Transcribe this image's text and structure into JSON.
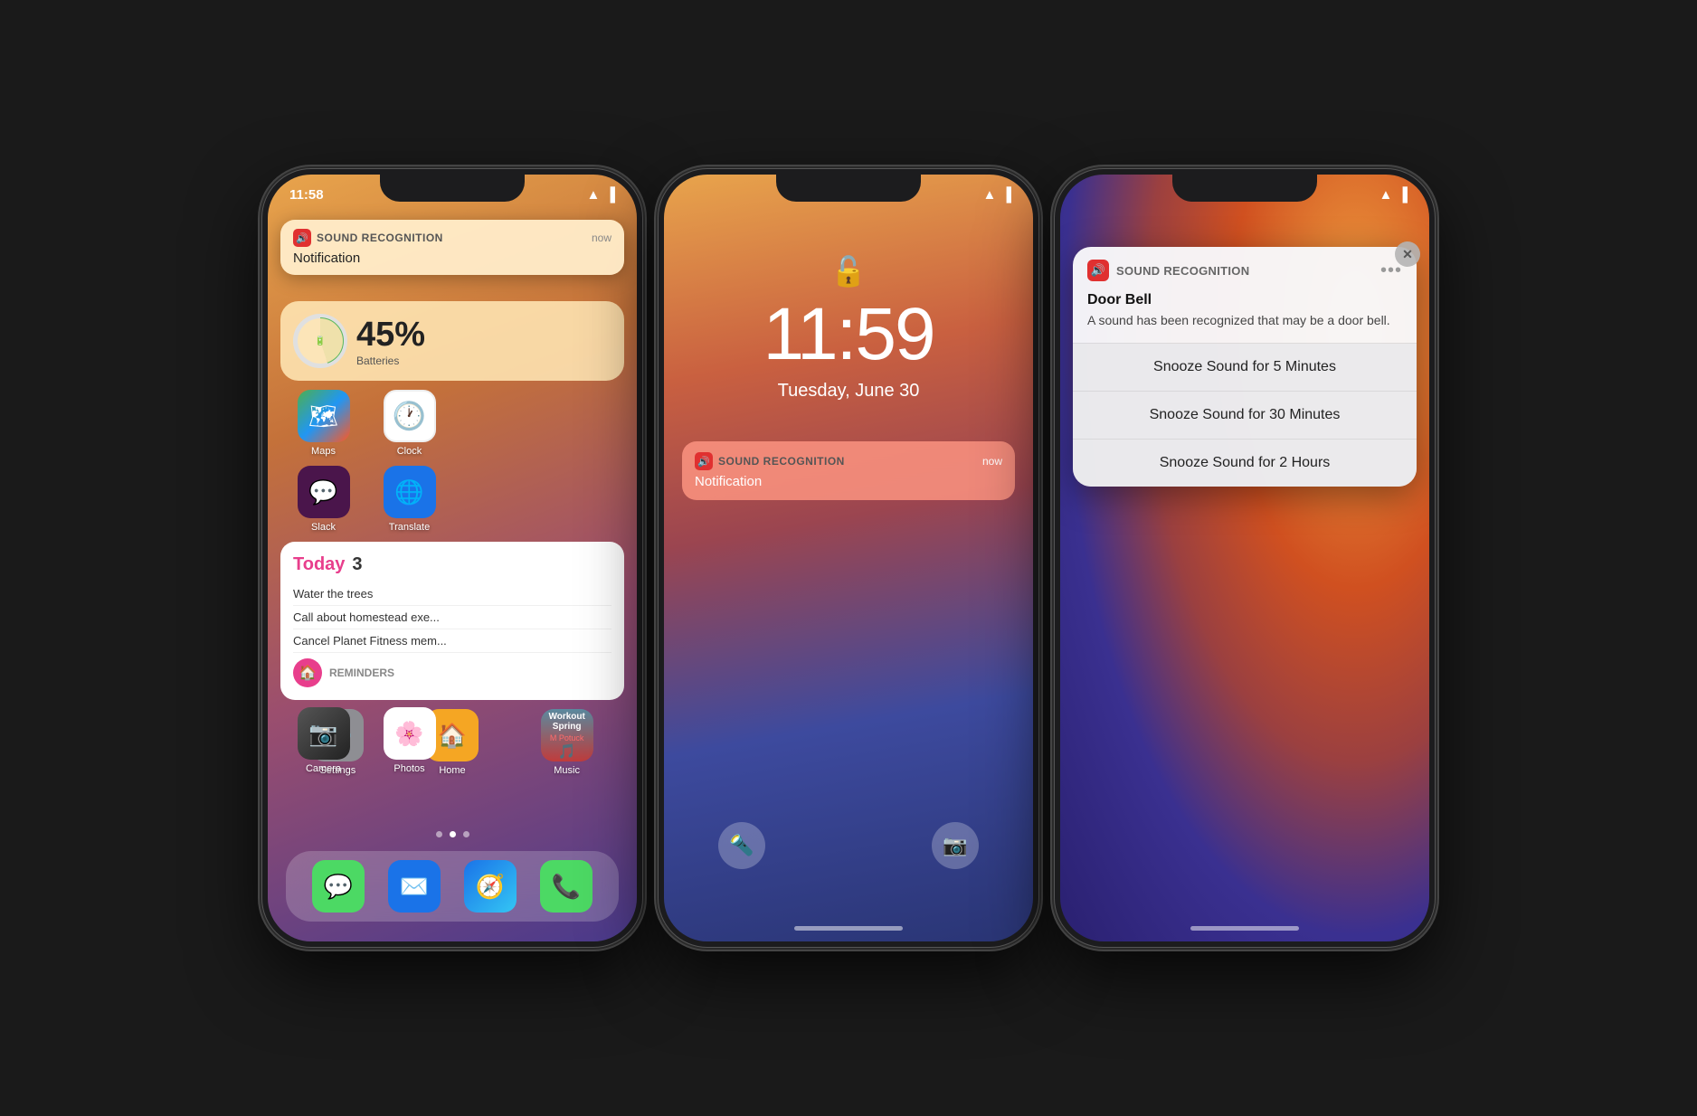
{
  "phone1": {
    "status": {
      "time": "11:58",
      "wifi": true,
      "battery": true
    },
    "notification": {
      "app_name": "SOUND RECOGNITION",
      "time": "now",
      "title": "Notification"
    },
    "battery_widget": {
      "percent": "45%",
      "label": "Batteries"
    },
    "apps_row1": [
      {
        "name": "Maps",
        "icon": "🗺"
      },
      {
        "name": "Clock",
        "icon": "🕐"
      }
    ],
    "apps_row2": [
      {
        "name": "Slack",
        "icon": "💬"
      },
      {
        "name": "Translate",
        "icon": "🌐"
      }
    ],
    "reminders": {
      "label": "Today",
      "count": "3",
      "items": [
        "Water the trees",
        "Call about homestead exe...",
        "Cancel Planet Fitness mem..."
      ],
      "section_label": "Reminders"
    },
    "apps_row3": [
      {
        "name": "Settings",
        "icon": "⚙️"
      },
      {
        "name": "Home",
        "icon": "🏠"
      }
    ],
    "music_card": {
      "title": "Workout Spring",
      "artist": "M Potuck"
    },
    "dock": [
      {
        "name": "Messages",
        "icon": "💬"
      },
      {
        "name": "Mail",
        "icon": "✉️"
      },
      {
        "name": "Safari",
        "icon": "🧭"
      },
      {
        "name": "Phone",
        "icon": "📞"
      }
    ]
  },
  "phone2": {
    "status": {
      "time": "",
      "wifi": true,
      "battery": true
    },
    "lock_time": "11:59",
    "lock_date": "Tuesday, June 30",
    "notification": {
      "app_name": "SOUND RECOGNITION",
      "time": "now",
      "title": "Notification"
    },
    "flashlight_icon": "🔦",
    "camera_icon": "📷"
  },
  "phone3": {
    "status": {
      "time": "",
      "wifi": true,
      "battery": true
    },
    "notification_card": {
      "app_name": "SOUND RECOGNITION",
      "title": "Door Bell",
      "description": "A sound has been recognized that may be a door bell."
    },
    "close_label": "✕",
    "snooze_options": [
      "Snooze Sound for 5 Minutes",
      "Snooze Sound for 30 Minutes",
      "Snooze Sound for 2 Hours"
    ]
  }
}
